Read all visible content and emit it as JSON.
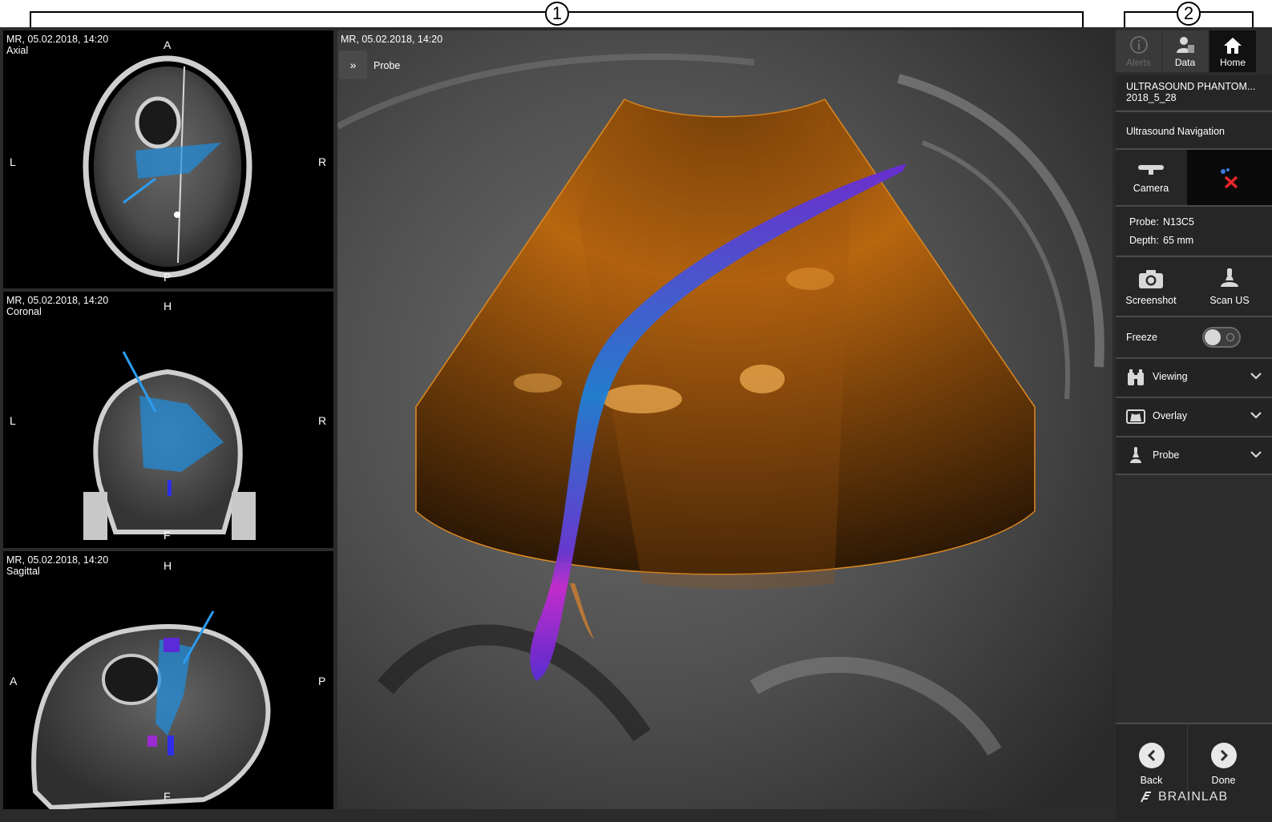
{
  "callouts": {
    "one": "1",
    "two": "2"
  },
  "views": {
    "axial": {
      "info_date": "MR, 05.02.2018, 14:20",
      "info_plane": "Axial",
      "top": "A",
      "left": "L",
      "right": "R",
      "bottom": "P"
    },
    "coronal": {
      "info_date": "MR, 05.02.2018, 14:20",
      "info_plane": "Coronal",
      "top": "H",
      "left": "L",
      "right": "R",
      "bottom": "F"
    },
    "sagittal": {
      "info_date": "MR, 05.02.2018, 14:20",
      "info_plane": "Sagittal",
      "top": "H",
      "left": "A",
      "right": "P",
      "bottom": "F"
    },
    "main": {
      "info_date": "MR, 05.02.2018, 14:20",
      "probe_label": "Probe"
    }
  },
  "panel": {
    "nav": {
      "alerts": "Alerts",
      "data": "Data",
      "home": "Home"
    },
    "patient_name": "ULTRASOUND PHANTOM...",
    "patient_id": "2018_5_28",
    "workflow": "Ultrasound Navigation",
    "camera_label": "Camera",
    "probe_label": "Probe:",
    "probe_value": "N13C5",
    "depth_label": "Depth:",
    "depth_value": "65 mm",
    "screenshot_label": "Screenshot",
    "scan_label": "Scan US",
    "freeze_label": "Freeze",
    "freeze_on": false,
    "accordions": {
      "viewing": "Viewing",
      "overlay": "Overlay",
      "probe": "Probe"
    },
    "back_label": "Back",
    "done_label": "Done",
    "brand": "BRAINLAB"
  },
  "colors": {
    "ultrasound": "#e08a1e",
    "fiber_start": "#6a2bd6",
    "fiber_mid": "#1f7fd6",
    "fiber_end": "#c52bd0",
    "panel_bg": "#2d2d2d",
    "alert_red": "#e8262b"
  }
}
